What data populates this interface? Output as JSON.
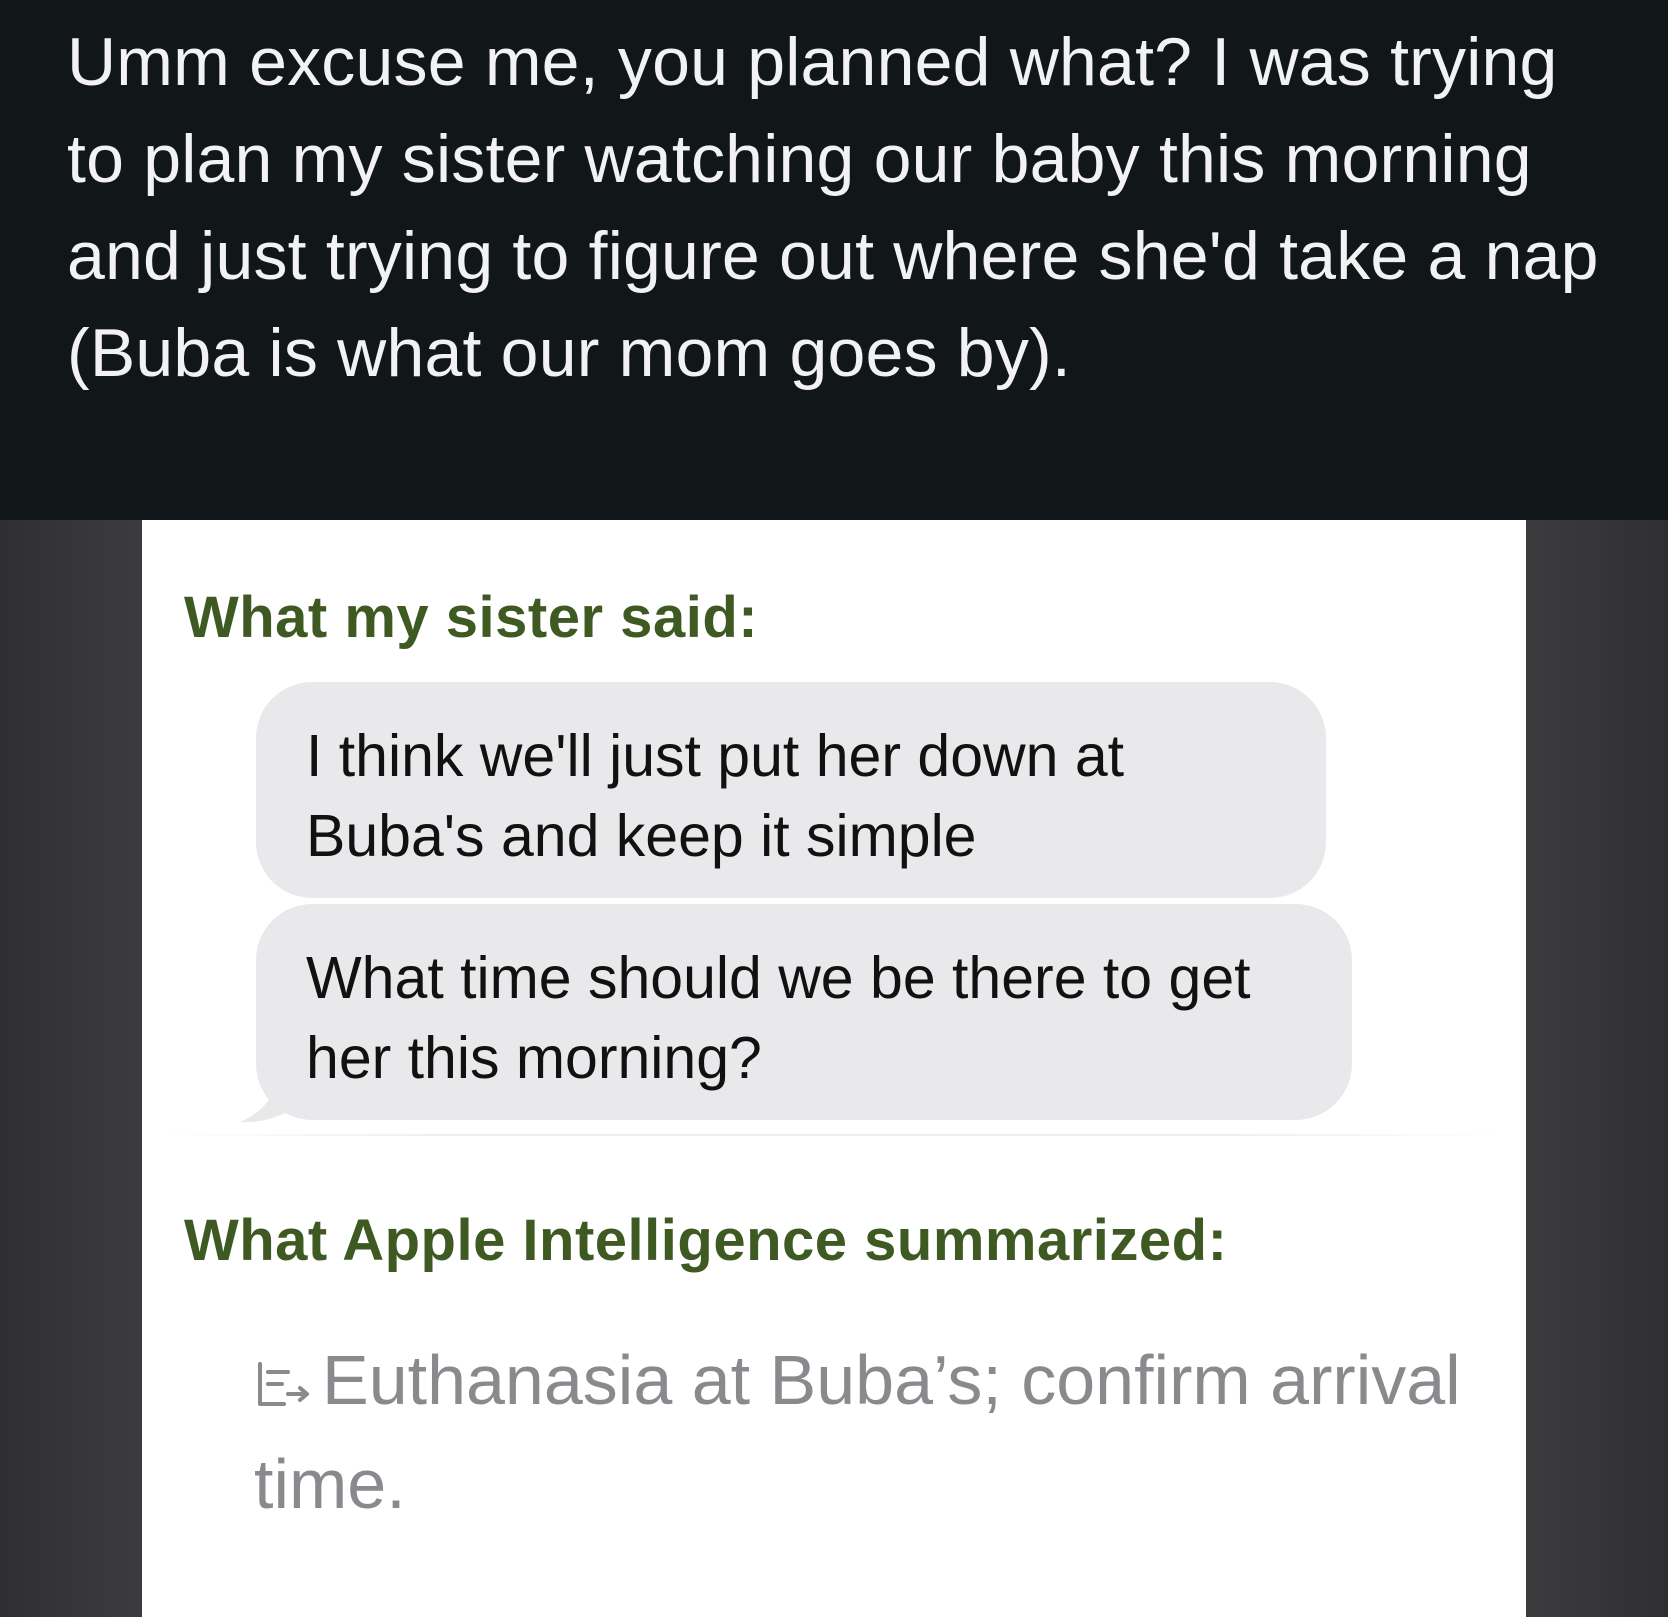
{
  "caption": {
    "text": "Umm excuse me, you planned what? I was trying to plan my sister watching our baby this morning and just trying to figure out where she'd take a nap (Buba is what our mom goes by)."
  },
  "panel": {
    "sister_heading": "What my sister said:",
    "messages": [
      "I think we'll just put her down at Buba's and keep it simple",
      "What time should we be there to get her this morning?"
    ],
    "apple_heading": "What Apple Intelligence summarized:",
    "summary": {
      "icon": "summary-icon",
      "text": "Euthanasia at Buba’s; confirm arrival time."
    }
  },
  "colors": {
    "caption_background": "#111719",
    "caption_text": "#f2f2f2",
    "heading_green": "#3e5a22",
    "bubble_gray": "#e9e9eb",
    "summary_gray": "#8a8a8e",
    "frame_gray": "#3a3a3c"
  }
}
